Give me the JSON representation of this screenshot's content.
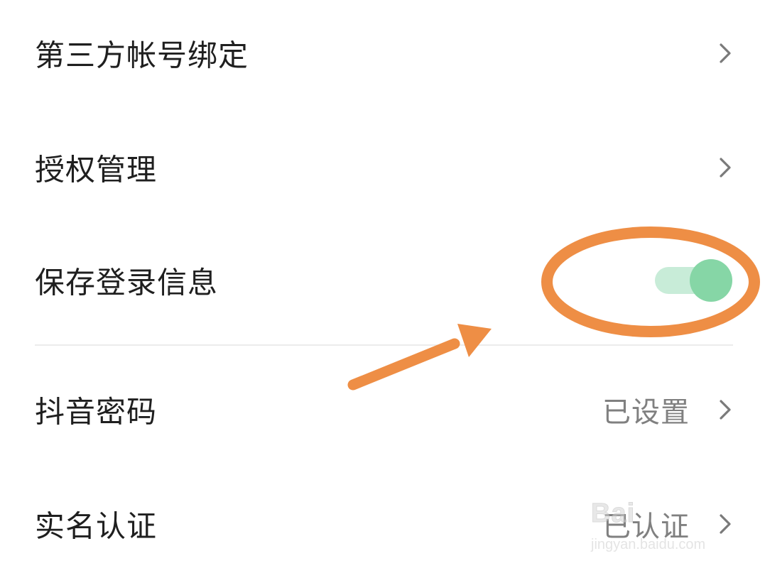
{
  "settings": {
    "rows": [
      {
        "label": "第三方帐号绑定",
        "value": ""
      },
      {
        "label": "授权管理",
        "value": ""
      },
      {
        "label": "保存登录信息",
        "toggle_on": true
      },
      {
        "label": "抖音密码",
        "value": "已设置"
      },
      {
        "label": "实名认证",
        "value": "已认证"
      }
    ]
  },
  "colors": {
    "toggle_track": "#c8ecd8",
    "toggle_knob": "#86d6a6",
    "annotation": "#ee8e45",
    "text_primary": "#1f1f1f",
    "text_secondary": "#808080",
    "chevron": "#7a7a7a"
  },
  "icons": {
    "chevron": "chevron-right-icon",
    "annotation_circle": "ellipse-highlight",
    "annotation_arrow": "arrow-icon"
  },
  "watermark": {
    "logo": "Bai",
    "url": "jingyan.baidu.com"
  }
}
